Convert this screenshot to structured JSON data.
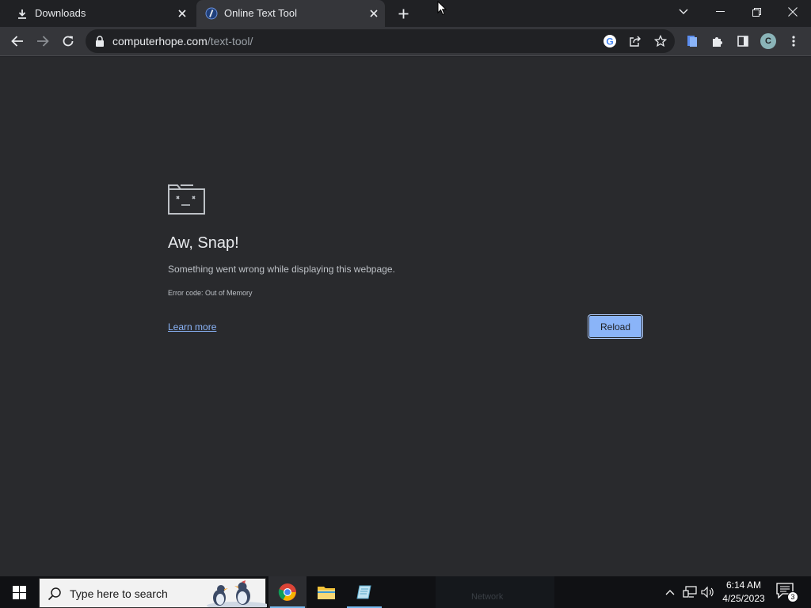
{
  "browser": {
    "tabs": [
      {
        "title": "Downloads",
        "icon": "download-icon",
        "active": false
      },
      {
        "title": "Online Text Tool",
        "icon": "favicon-computerhope-icon",
        "active": true
      }
    ],
    "address": {
      "host": "computerhope.com",
      "path": "/text-tool/"
    },
    "profile_initial": "C"
  },
  "error_page": {
    "heading": "Aw, Snap!",
    "message": "Something went wrong while displaying this webpage.",
    "error_code": "Error code: Out of Memory",
    "learn_more": "Learn more",
    "reload": "Reload"
  },
  "taskbar": {
    "search_placeholder": "Type here to search",
    "apps": [
      "chrome-icon",
      "file-explorer-icon",
      "notepad-icon"
    ],
    "ghost_label": "Network",
    "time": "6:14 AM",
    "date": "4/25/2023",
    "notification_count": "3"
  },
  "colors": {
    "page_background": "#292a2d",
    "toolbar": "#35363a",
    "accent_button": "#8ab4f8",
    "link": "#8ab4f8"
  }
}
